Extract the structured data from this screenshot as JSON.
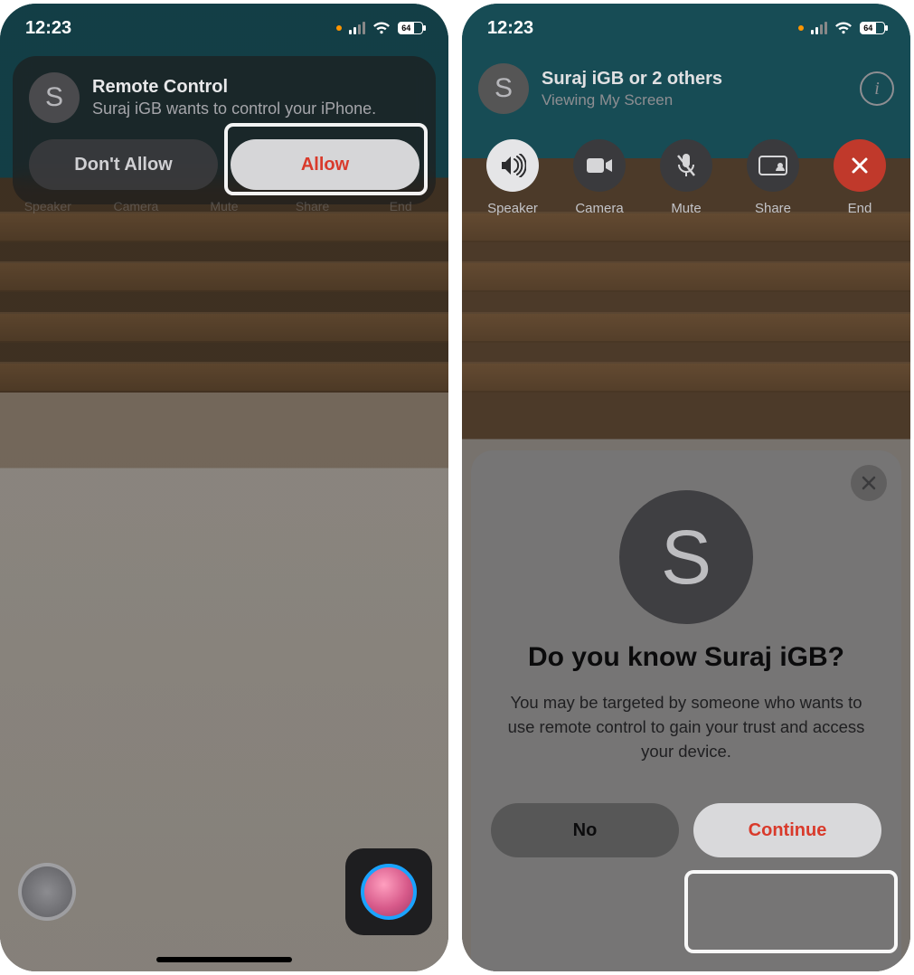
{
  "status": {
    "time": "12:23",
    "battery": "64"
  },
  "left": {
    "notification": {
      "avatar_letter": "S",
      "title": "Remote Control",
      "subtitle": "Suraj iGB wants to control your iPhone.",
      "deny_label": "Don't Allow",
      "allow_label": "Allow"
    },
    "ghost_controls": [
      "Speaker",
      "Camera",
      "Mute",
      "Share",
      "End"
    ]
  },
  "right": {
    "header": {
      "avatar_letter": "S",
      "title": "Suraj iGB or 2 others",
      "subtitle": "Viewing My Screen"
    },
    "controls": {
      "speaker": "Speaker",
      "camera": "Camera",
      "mute": "Mute",
      "share": "Share",
      "end": "End"
    },
    "sheet": {
      "avatar_letter": "S",
      "heading": "Do you know Suraj iGB?",
      "body": "You may be targeted by someone who wants to use remote control to gain your trust and access your device.",
      "no_label": "No",
      "continue_label": "Continue"
    }
  }
}
